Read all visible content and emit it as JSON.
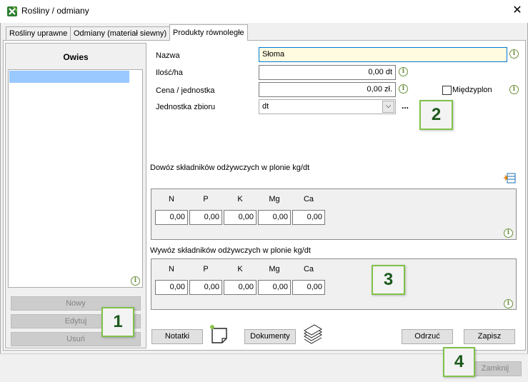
{
  "window": {
    "title": "Rośliny / odmiany",
    "close_glyph": "✕"
  },
  "tabs": [
    {
      "label": "Rośliny uprawne"
    },
    {
      "label": "Odmiany (materiał siewny)"
    },
    {
      "label": "Produkty równoległe"
    }
  ],
  "left": {
    "header": "Owies",
    "buttons": {
      "new": "Nowy",
      "edit": "Edytuj",
      "delete": "Usuń"
    }
  },
  "form": {
    "name_label": "Nazwa",
    "name_value": "Słoma",
    "qty_label": "Ilość/ha",
    "qty_value": "0,00 dt",
    "price_label": "Cena / jednostka",
    "price_value": "0,00 zł.",
    "unit_label": "Jednostka zbioru",
    "unit_value": "dt",
    "ellipsis": "...",
    "catch_crop_label": "Międzyplon"
  },
  "import_section": {
    "title": "Dowóz składników odżywczych w plonie kg/dt",
    "columns": [
      "N",
      "P",
      "K",
      "Mg",
      "Ca"
    ],
    "values": [
      "0,00",
      "0,00",
      "0,00",
      "0,00",
      "0,00"
    ]
  },
  "export_section": {
    "title": "Wywóz składników odżywczych w plonie kg/dt",
    "columns": [
      "N",
      "P",
      "K",
      "Mg",
      "Ca"
    ],
    "values": [
      "0,00",
      "0,00",
      "0,00",
      "0,00",
      "0,00"
    ]
  },
  "actions": {
    "notes": "Notatki",
    "documents": "Dokumenty",
    "reject": "Odrzuć",
    "save": "Zapisz",
    "close": "Zamknij"
  },
  "callouts": [
    "1",
    "2",
    "3",
    "4"
  ],
  "icons": {
    "info": "i",
    "colors": {
      "info": "#6b8f3a",
      "callout_border": "#7fc24a",
      "callout_text": "#1c5a1c",
      "selection": "#99c9ff"
    }
  }
}
